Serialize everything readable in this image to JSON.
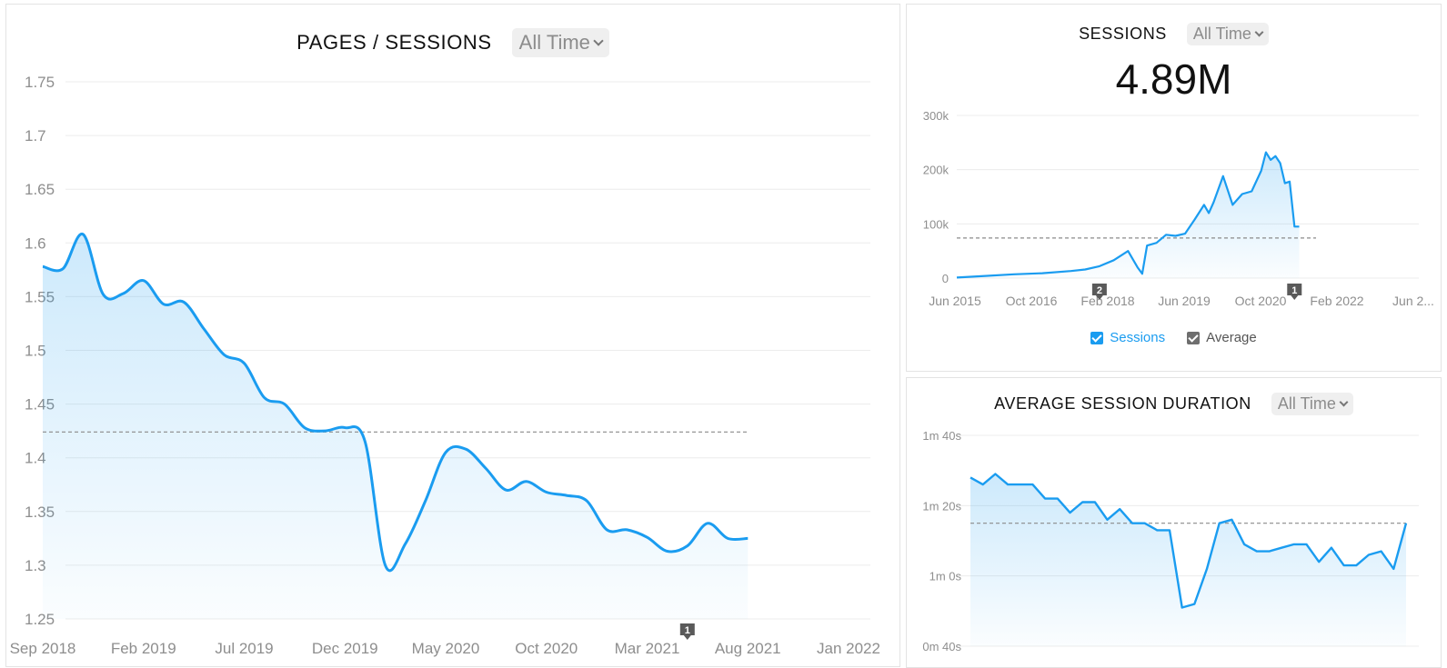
{
  "colors": {
    "line": "#1a9cf0",
    "average": "#8a8a8a",
    "grid": "#ececec",
    "axis_text": "#8e8e8e",
    "marker": "#5a5a5a"
  },
  "pages_sessions": {
    "title": "PAGES / SESSIONS",
    "range_label": "All Time"
  },
  "sessions": {
    "title": "SESSIONS",
    "range_label": "All Time",
    "total": "4.89M",
    "legend": {
      "series": "Sessions",
      "average": "Average"
    }
  },
  "avg_duration": {
    "title": "AVERAGE SESSION DURATION",
    "range_label": "All Time"
  },
  "chart_data": [
    {
      "id": "pages_sessions",
      "type": "area",
      "title": "PAGES / SESSIONS",
      "x_ticks": [
        "Sep 2018",
        "Feb 2019",
        "Jul 2019",
        "Dec 2019",
        "May 2020",
        "Oct 2020",
        "Mar 2021",
        "Aug 2021",
        "Jan 2022"
      ],
      "y_ticks": [
        "1.25",
        "1.3",
        "1.35",
        "1.4",
        "1.45",
        "1.5",
        "1.55",
        "1.6",
        "1.65",
        "1.7",
        "1.75"
      ],
      "ylim": [
        1.25,
        1.75
      ],
      "x_start": "2018-09",
      "x_end": "2022-01",
      "average": 1.424,
      "annotation": {
        "label": "1",
        "x": "2021-05"
      },
      "x": [
        "2018-09",
        "2018-10",
        "2018-11",
        "2018-12",
        "2019-01",
        "2019-02",
        "2019-03",
        "2019-04",
        "2019-05",
        "2019-06",
        "2019-07",
        "2019-08",
        "2019-09",
        "2019-10",
        "2019-11",
        "2019-12",
        "2020-01",
        "2020-02",
        "2020-03",
        "2020-04",
        "2020-05",
        "2020-06",
        "2020-07",
        "2020-08",
        "2020-09",
        "2020-10",
        "2020-11",
        "2020-12",
        "2021-01",
        "2021-02",
        "2021-03",
        "2021-04",
        "2021-05",
        "2021-06",
        "2021-07",
        "2021-08"
      ],
      "values": [
        1.578,
        1.576,
        1.608,
        1.552,
        1.553,
        1.565,
        1.543,
        1.545,
        1.52,
        1.496,
        1.488,
        1.456,
        1.45,
        1.428,
        1.425,
        1.428,
        1.415,
        1.3,
        1.32,
        1.36,
        1.405,
        1.408,
        1.39,
        1.37,
        1.378,
        1.368,
        1.365,
        1.36,
        1.333,
        1.333,
        1.326,
        1.313,
        1.318,
        1.339,
        1.325,
        1.325
      ]
    },
    {
      "id": "sessions",
      "type": "area",
      "title": "SESSIONS",
      "x_ticks": [
        "Jun 2015",
        "Oct 2016",
        "Feb 2018",
        "Jun 2019",
        "Oct 2020",
        "Feb 2022",
        "Jun 2..."
      ],
      "y_ticks": [
        "0",
        "100k",
        "200k",
        "300k"
      ],
      "ylim": [
        0,
        300000
      ],
      "x_start": "2015-06",
      "x_end": "2023-06",
      "average": 74000,
      "annotations": [
        {
          "label": "2",
          "x": "2017-12"
        },
        {
          "label": "1",
          "x": "2021-05"
        }
      ],
      "x": [
        "2015-06",
        "2015-12",
        "2016-06",
        "2016-12",
        "2017-06",
        "2017-09",
        "2017-12",
        "2018-03",
        "2018-06",
        "2018-08",
        "2018-09",
        "2018-10",
        "2018-12",
        "2019-02",
        "2019-04",
        "2019-06",
        "2019-08",
        "2019-10",
        "2019-11",
        "2019-12",
        "2020-02",
        "2020-04",
        "2020-06",
        "2020-08",
        "2020-10",
        "2020-11",
        "2020-12",
        "2021-01",
        "2021-02",
        "2021-03",
        "2021-04",
        "2021-05",
        "2021-06"
      ],
      "values": [
        1000,
        4000,
        7000,
        9000,
        13000,
        16000,
        22000,
        33000,
        50000,
        20000,
        8000,
        60000,
        65000,
        80000,
        78000,
        82000,
        108000,
        135000,
        120000,
        140000,
        188000,
        135000,
        155000,
        160000,
        198000,
        232000,
        218000,
        225000,
        212000,
        175000,
        178000,
        95000,
        95000
      ],
      "series_name": "Sessions"
    },
    {
      "id": "avg_duration",
      "type": "area",
      "title": "AVERAGE SESSION DURATION",
      "x_ticks": [],
      "y_ticks": [
        "0m 40s",
        "1m 0s",
        "1m 20s",
        "1m 40s"
      ],
      "ylim_seconds": [
        40,
        100
      ],
      "average_seconds": 75,
      "values_seconds": [
        88,
        86,
        89,
        86,
        86,
        86,
        82,
        82,
        78,
        81,
        81,
        76,
        79,
        75,
        75,
        73,
        73,
        51,
        52,
        62,
        75,
        76,
        69,
        67,
        67,
        68,
        69,
        69,
        64,
        68,
        63,
        63,
        66,
        67,
        62,
        75
      ]
    }
  ]
}
